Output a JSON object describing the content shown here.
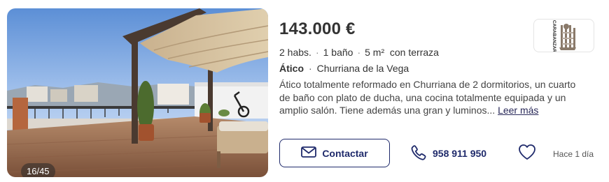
{
  "listing": {
    "photo_counter": "16/45",
    "price": "143.000 €",
    "features": [
      "2 habs.",
      "1 baño",
      "5 m²",
      "con terraza"
    ],
    "property_type": "Ático",
    "location": "Churriana de la Vega",
    "description": "Ático totalmente reformado en Churriana de 2 dormitorios, un cuarto de baño con plato de ducha, una cocina totalmente equipada y un amplio salón. Tiene además una gran y luminos...",
    "read_more": "Leer más",
    "agency_logo_text": "CARABANZAR",
    "contact_label": "Contactar",
    "phone": "958 911 950",
    "posted": "Hace 1 día"
  },
  "icons": {
    "contact": "envelope-icon",
    "phone": "phone-icon",
    "favorite": "heart-icon"
  },
  "colors": {
    "accent": "#1f2a6b",
    "text": "#333333"
  }
}
